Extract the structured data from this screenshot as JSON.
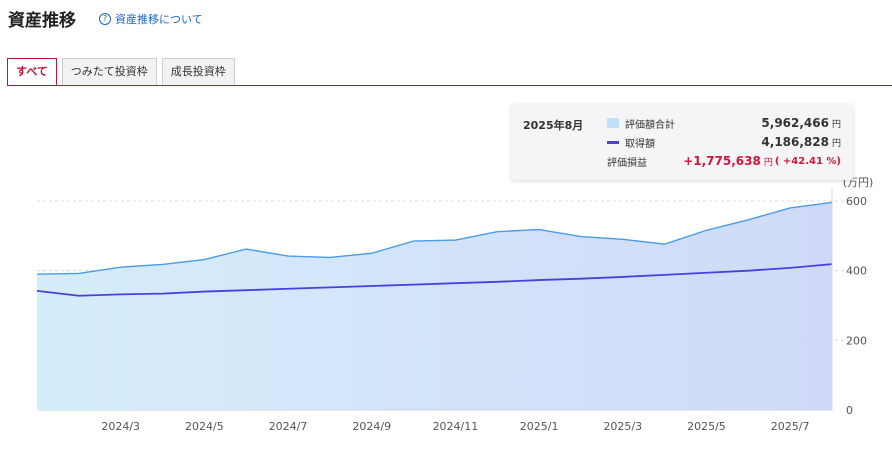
{
  "header": {
    "title": "資産推移",
    "help_link": "資産推移について"
  },
  "tabs": [
    {
      "label": "すべて",
      "active": true
    },
    {
      "label": "つみたて投資枠",
      "active": false
    },
    {
      "label": "成長投資枠",
      "active": false
    }
  ],
  "tooltip": {
    "date": "2025年8月",
    "valuation_label": "評価額合計",
    "valuation_value": "5,962,466",
    "cost_label": "取得額",
    "cost_value": "4,186,828",
    "pl_label": "評価損益",
    "pl_value": "+1,775,638",
    "pl_pct": "( +42.41 %)",
    "unit": "円"
  },
  "chart_data": {
    "type": "area",
    "y_unit_label": "(万円)",
    "ylim": [
      0,
      600
    ],
    "y_ticks": [
      0,
      200,
      400,
      600
    ],
    "x": [
      "2024/1",
      "2024/2",
      "2024/3",
      "2024/4",
      "2024/5",
      "2024/6",
      "2024/7",
      "2024/8",
      "2024/9",
      "2024/10",
      "2024/11",
      "2024/12",
      "2025/1",
      "2025/2",
      "2025/3",
      "2025/4",
      "2025/5",
      "2025/6",
      "2025/7",
      "2025/8"
    ],
    "x_tick_labels": [
      "2024/3",
      "2024/5",
      "2024/7",
      "2024/9",
      "2024/11",
      "2025/1",
      "2025/3",
      "2025/5",
      "2025/7"
    ],
    "x_tick_indices": [
      2,
      4,
      6,
      8,
      10,
      12,
      14,
      16,
      18
    ],
    "series": [
      {
        "name": "評価額合計",
        "kind": "area",
        "color": "#4a9be8",
        "values": [
          390,
          392,
          410,
          418,
          432,
          462,
          442,
          438,
          450,
          485,
          488,
          512,
          518,
          498,
          490,
          476,
          516,
          546,
          580,
          596
        ]
      },
      {
        "name": "取得額",
        "kind": "line",
        "color": "#4b3fe0",
        "values": [
          342,
          328,
          332,
          334,
          340,
          344,
          348,
          352,
          356,
          360,
          364,
          368,
          373,
          377,
          382,
          388,
          394,
          400,
          408,
          418.7
        ]
      }
    ],
    "grid": true,
    "colors": {
      "area_fill_left": "#d3ecfb",
      "area_fill_right": "#cdd8f7",
      "grid": "#d8d8d8"
    }
  }
}
